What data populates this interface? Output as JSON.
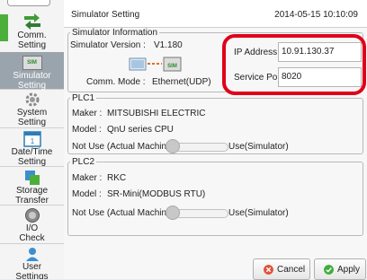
{
  "sidebar": {
    "items": [
      {
        "label": "Comm.\nSetting"
      },
      {
        "label": "Simulator\nSetting"
      },
      {
        "label": "System\nSetting"
      },
      {
        "label": "Date/Time\nSetting"
      },
      {
        "label": "Storage\nTransfer"
      },
      {
        "label": "I/O\nCheck"
      },
      {
        "label": "User\nSettings"
      }
    ],
    "sim_icon_text": "SIM"
  },
  "header": {
    "title": "Simulator Setting",
    "datetime": "2014-05-15 10:10:09"
  },
  "sim_info": {
    "legend": "Simulator Information",
    "version_label": "Simulator Version :",
    "version_value": "V1.180",
    "comm_mode_label": "Comm. Mode :",
    "comm_mode_value": "Ethernet(UDP)",
    "ip_label": "IP Address",
    "ip_value": "10.91.130.37",
    "port_label": "Service Port",
    "port_value": "8020"
  },
  "plc1": {
    "legend": "PLC1",
    "maker_label": "Maker :",
    "maker_value": "MITSUBISHI ELECTRIC",
    "model_label": "Model :",
    "model_value": "QnU series CPU",
    "left_label": "Not Use (Actual Machine)",
    "right_label": "Use(Simulator)"
  },
  "plc2": {
    "legend": "PLC2",
    "maker_label": "Maker :",
    "maker_value": "RKC",
    "model_label": "Model :",
    "model_value": "SR-Mini(MODBUS RTU)",
    "left_label": "Not Use (Actual Machine)",
    "right_label": "Use(Simulator)"
  },
  "actions": {
    "cancel_label": "Cancel",
    "apply_label": "Apply"
  },
  "colors": {
    "highlight": "#e0001a",
    "cancel_icon": "#e0533b",
    "apply_icon": "#3fae3f",
    "sidebar_active": "#9aa4ad"
  }
}
